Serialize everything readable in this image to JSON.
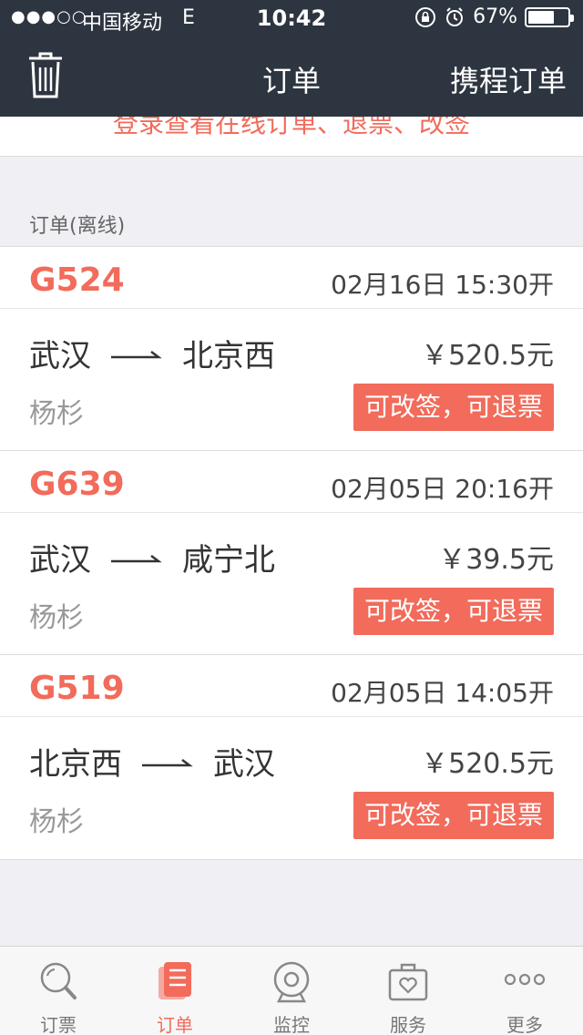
{
  "status_bar": {
    "signal": "●●●○○",
    "carrier": "中国移动",
    "network": "E",
    "time": "10:42",
    "battery_percent": "67%",
    "battery_level": 0.67
  },
  "navbar": {
    "title": "订单",
    "right_label": "携程订单"
  },
  "login_hint": "登录查看在线订单、退票、改签",
  "section_label": "订单(离线)",
  "orders": [
    {
      "train_no": "G524",
      "depart": "02月16日 15:30开",
      "from": "武汉",
      "to": "北京西",
      "price": "￥520.5元",
      "passenger": "杨杉",
      "status": "可改签，可退票"
    },
    {
      "train_no": "G639",
      "depart": "02月05日 20:16开",
      "from": "武汉",
      "to": "咸宁北",
      "price": "￥39.5元",
      "passenger": "杨杉",
      "status": "可改签，可退票"
    },
    {
      "train_no": "G519",
      "depart": "02月05日 14:05开",
      "from": "北京西",
      "to": "武汉",
      "price": "￥520.5元",
      "passenger": "杨杉",
      "status": "可改签，可退票"
    }
  ],
  "tabbar": [
    {
      "label": "订票",
      "icon": "search-icon"
    },
    {
      "label": "订单",
      "icon": "document-icon",
      "active": true
    },
    {
      "label": "监控",
      "icon": "camera-icon"
    },
    {
      "label": "服务",
      "icon": "briefcase-heart-icon"
    },
    {
      "label": "更多",
      "icon": "more-dots-icon"
    }
  ],
  "colors": {
    "header_bg": "#2d3540",
    "accent": "#f26b5b",
    "page_bg": "#efeff4"
  }
}
